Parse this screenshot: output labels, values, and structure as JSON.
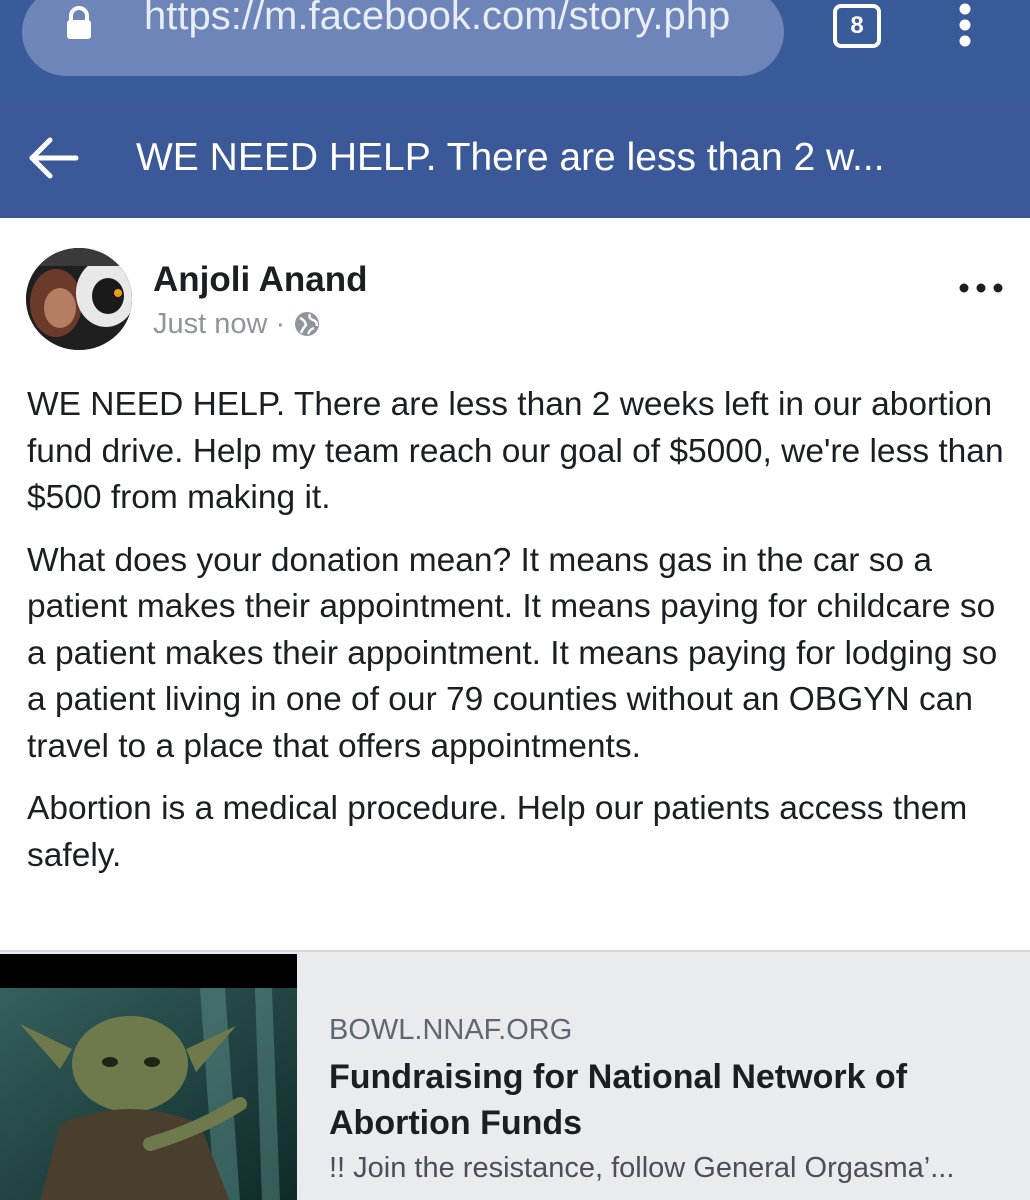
{
  "browser": {
    "url": "https://m.facebook.com/story.php",
    "tab_count": "8"
  },
  "header": {
    "title": "WE NEED HELP. There are less than 2 w..."
  },
  "post": {
    "author": "Anjoli Anand",
    "timestamp": "Just now",
    "separator": "·",
    "paragraphs": [
      "WE NEED HELP. There are less than 2 weeks left in our abortion fund drive. Help my team reach our goal of $5000, we're less than $500 from making it.",
      "What does your donation mean? It means gas in the car so a patient makes their appointment. It means paying for childcare so a patient makes their appointment. It means paying for lodging so a patient living in one of our 79 counties without an OBGYN can travel to a place that offers appointments.",
      "Abortion is a medical procedure. Help our patients access them safely."
    ]
  },
  "link_preview": {
    "domain": "BOWL.NNAF.ORG",
    "title": "Fundraising for National Network of Abortion Funds",
    "description": "!! Join the resistance, follow General Orgasma’..."
  },
  "colors": {
    "browser_bar": "#3a5b9a",
    "fb_blue": "#3b5998",
    "link_card_bg": "#e9ebee"
  }
}
